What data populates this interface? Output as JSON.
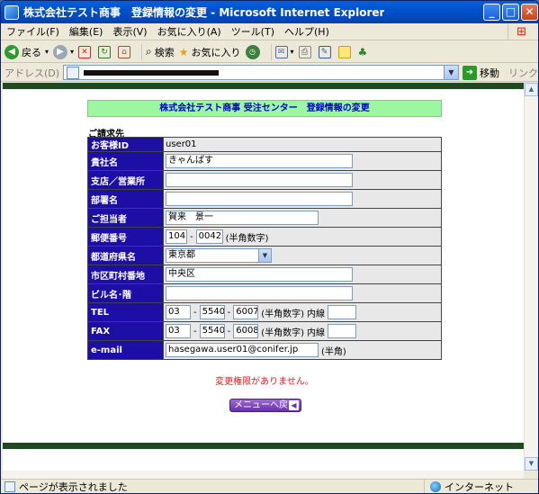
{
  "window": {
    "title": "株式会社テスト商事　登録情報の変更 - Microsoft Internet Explorer",
    "minimize": "_",
    "maximize": "□",
    "close": "✕"
  },
  "menu": [
    "ファイル(F)",
    "編集(E)",
    "表示(V)",
    "お気に入り(A)",
    "ツール(T)",
    "ヘルプ(H)"
  ],
  "toolbar": {
    "back": "戻る",
    "search": "検索",
    "favorites": "お気に入り"
  },
  "address": {
    "label": "アドレス(D)",
    "go": "移動",
    "links": "リンク"
  },
  "page": {
    "header": "株式会社テスト商事 受注センター　登録情報の変更",
    "section": "ご請求先",
    "fields": {
      "customer_id_label": "お客様ID",
      "customer_id": "user01",
      "company_label": "貴社名",
      "company": "きゃんぱす",
      "branch_label": "支店／営業所",
      "branch": "",
      "dept_label": "部署名",
      "dept": "",
      "contact_label": "ご担当者",
      "contact": "賀来　景一",
      "zip_label": "郵便番号",
      "zip1": "104",
      "zip2": "0042",
      "zip_note": "(半角数字)",
      "pref_label": "都道府県名",
      "pref": "東京都",
      "city_label": "市区町村番地",
      "city": "中央区",
      "building_label": "ビル名･階",
      "building": "",
      "tel_label": "TEL",
      "tel1": "03",
      "tel2": "5540",
      "tel3": "6007",
      "tel_note": "(半角数字)",
      "tel_ext_label": "内線",
      "tel_ext": "",
      "fax_label": "FAX",
      "fax1": "03",
      "fax2": "5540",
      "fax3": "6008",
      "fax_note": "(半角数字)",
      "fax_ext_label": "内線",
      "fax_ext": "",
      "email_label": "e-mail",
      "email": "hasegawa.user01@conifer.jp",
      "email_note": "(半角)"
    },
    "dash": "-",
    "error": "変更権限がありません。",
    "menu_button": "メニューへ戻る",
    "menu_button_arrow": "◀"
  },
  "status": {
    "left": "ページが表示されました",
    "zone": "インターネット"
  }
}
